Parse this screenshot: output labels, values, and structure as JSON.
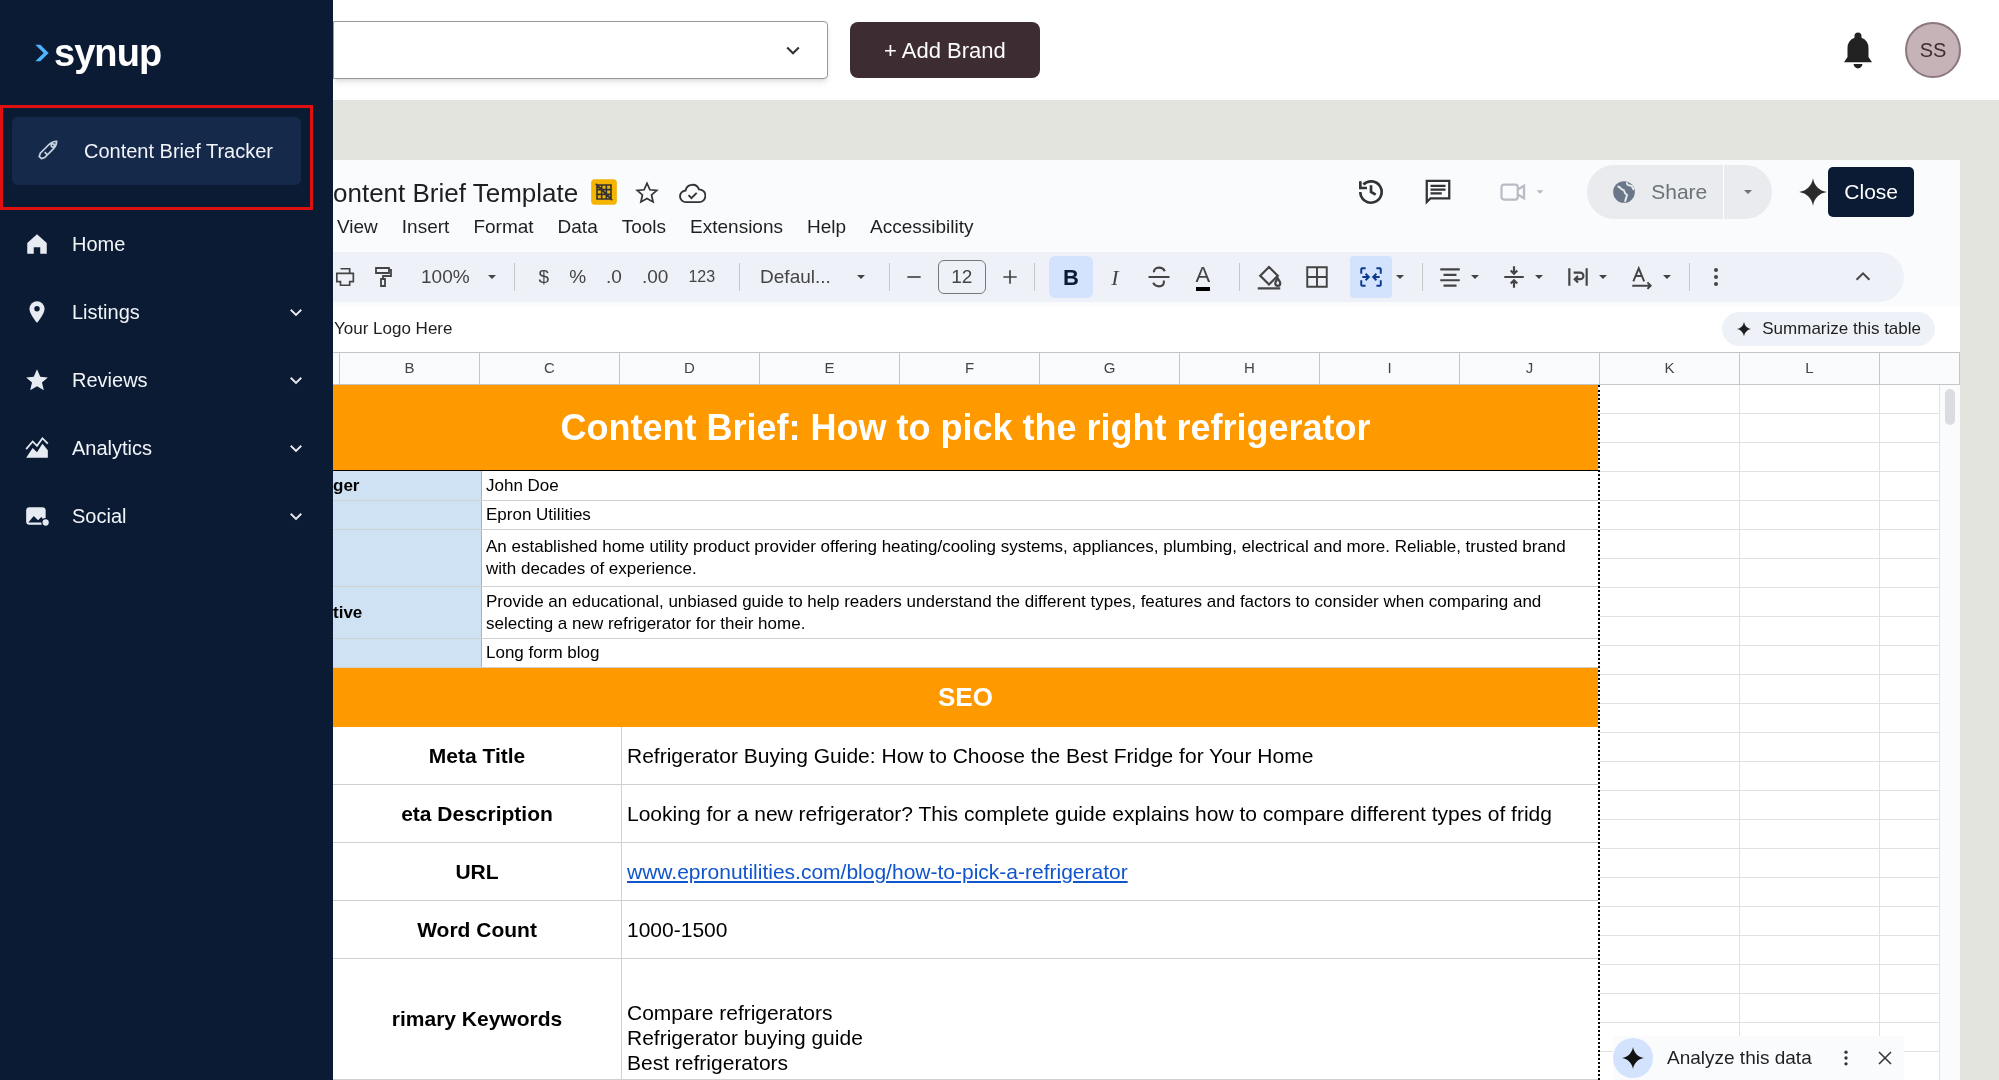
{
  "sidebar": {
    "logo": "synup",
    "items": [
      {
        "label": "Content Brief Tracker",
        "selected": true,
        "expandable": false
      },
      {
        "label": "Home",
        "selected": false,
        "expandable": false
      },
      {
        "label": "Listings",
        "selected": false,
        "expandable": true
      },
      {
        "label": "Reviews",
        "selected": false,
        "expandable": true
      },
      {
        "label": "Analytics",
        "selected": false,
        "expandable": true
      },
      {
        "label": "Social",
        "selected": false,
        "expandable": true
      }
    ]
  },
  "topbar": {
    "add_button": "+ Add Brand",
    "avatar": "SS"
  },
  "sheet": {
    "title": "ontent Brief Template",
    "menu": [
      "View",
      "Insert",
      "Format",
      "Data",
      "Tools",
      "Extensions",
      "Help",
      "Accessibility"
    ],
    "share": "Share",
    "close": "Close",
    "toolbar": {
      "zoom": "100%",
      "number_formats": [
        "$",
        "%",
        ".0",
        ".00",
        "123"
      ],
      "font": "Defaul...",
      "font_size": "12",
      "format_buttons": [
        {
          "label": "B",
          "kind": "bold",
          "selected": true
        },
        {
          "label": "I",
          "kind": "italic",
          "selected": false
        },
        {
          "label": "A",
          "kind": "color",
          "selected": false
        }
      ],
      "merge_selected": true
    },
    "logo_cell": "Your Logo Here",
    "summarize": "Summarize this table",
    "columns": [
      "B",
      "C",
      "D",
      "E",
      "F",
      "G",
      "H",
      "I",
      "J",
      "K",
      "L"
    ],
    "banner": "Content Brief: How to pick the right refrigerator",
    "info_rows": [
      {
        "label": "ger",
        "value": "John Doe"
      },
      {
        "value": "Epron Utilities"
      },
      {
        "value": "An established home utility product provider offering heating/cooling systems, appliances, plumbing, electrical and more. Reliable, trusted brand with decades of experience."
      },
      {
        "label": "tive",
        "value": "Provide an educational, unbiased guide to help readers understand the different types, features and factors to consider when comparing and selecting a new refrigerator for their home."
      },
      {
        "value": "Long form blog"
      }
    ],
    "section": "SEO",
    "seo_rows": [
      {
        "label": "Meta Title",
        "kind": "text",
        "values": [
          "Refrigerator Buying Guide: How to Choose the Best Fridge for Your Home"
        ]
      },
      {
        "label": "eta Description",
        "kind": "text",
        "values": [
          "Looking for a new refrigerator? This complete guide explains how to compare different types of fridg"
        ]
      },
      {
        "label": "URL",
        "kind": "link",
        "values": [
          "www.epronutilities.com/blog/how-to-pick-a-refrigerator"
        ]
      },
      {
        "label": "Word Count",
        "kind": "text",
        "values": [
          "1000-1500"
        ]
      },
      {
        "label": "rimary Keywords",
        "kind": "list",
        "values": [
          "Compare refrigerators",
          "Refrigerator buying guide",
          "Best refrigerators"
        ]
      }
    ],
    "analyze": "Analyze this data"
  }
}
